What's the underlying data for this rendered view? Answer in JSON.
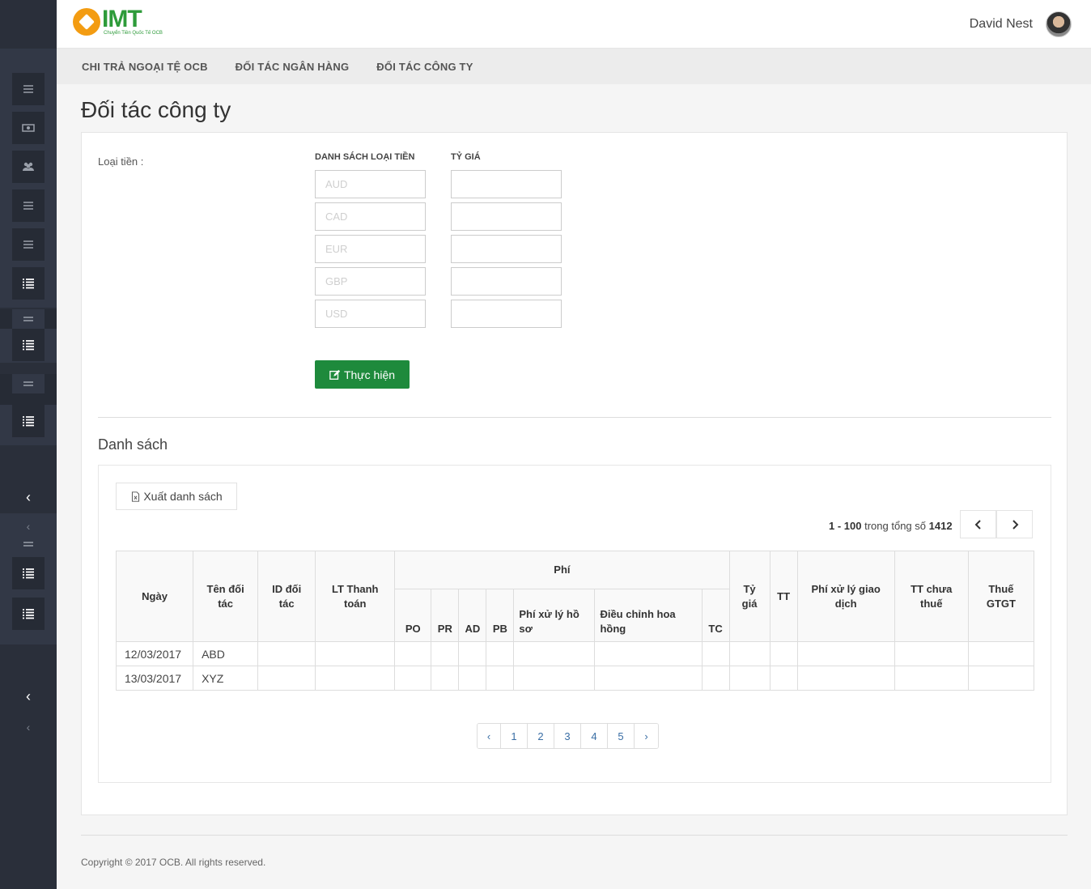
{
  "header": {
    "logo_text": "IMT",
    "logo_tagline": "Chuyển Tiền Quốc Tế OCB",
    "user_name": "David Nest"
  },
  "nav": [
    {
      "label": "CHI TRẢ NGOẠI TỆ OCB"
    },
    {
      "label": "ĐỐI TÁC NGÂN HÀNG"
    },
    {
      "label": "ĐỐI TÁC CÔNG TY"
    }
  ],
  "page_title": "Đối tác công ty",
  "form": {
    "currency_label": "Loại tiền :",
    "currency_list_header": "DANH SÁCH LOẠI TIỀN",
    "rate_header": "TỶ GIÁ",
    "currencies": [
      "AUD",
      "CAD",
      "EUR",
      "GBP",
      "USD"
    ],
    "submit_label": "Thực hiện"
  },
  "list": {
    "title": "Danh sách",
    "export_label": "Xuất danh sách",
    "summary_range": "1 - 100",
    "summary_text": "trong tổng số",
    "summary_total": "1412",
    "columns": {
      "date": "Ngày",
      "partner_name": "Tên đối tác",
      "partner_id": "ID đối tác",
      "currency": "LT Thanh toán",
      "fee_group": "Phí",
      "po": "PO",
      "pr": "PR",
      "ad": "AD",
      "pb": "PB",
      "fee_profile": "Phí xử lý hồ sơ",
      "commission": "Điều chỉnh hoa hồng",
      "tc": "TC",
      "rate": "Tỷ giá",
      "tt": "TT",
      "tx_fee": "Phí xử lý giao dịch",
      "pre_tax": "TT chưa thuế",
      "vat": "Thuế GTGT"
    },
    "rows": [
      {
        "date": "12/03/2017",
        "partner_name": "ABD"
      },
      {
        "date": "13/03/2017",
        "partner_name": "XYZ"
      }
    ],
    "pages": [
      "1",
      "2",
      "3",
      "4",
      "5"
    ]
  },
  "footer": {
    "copyright": "Copyright © 2017 OCB. All rights reserved."
  },
  "colors": {
    "sidebar": "#2a2f3a",
    "primary_button": "#1e8a3c",
    "logo_green": "#2e9b3a",
    "logo_orange": "#f39c12"
  }
}
